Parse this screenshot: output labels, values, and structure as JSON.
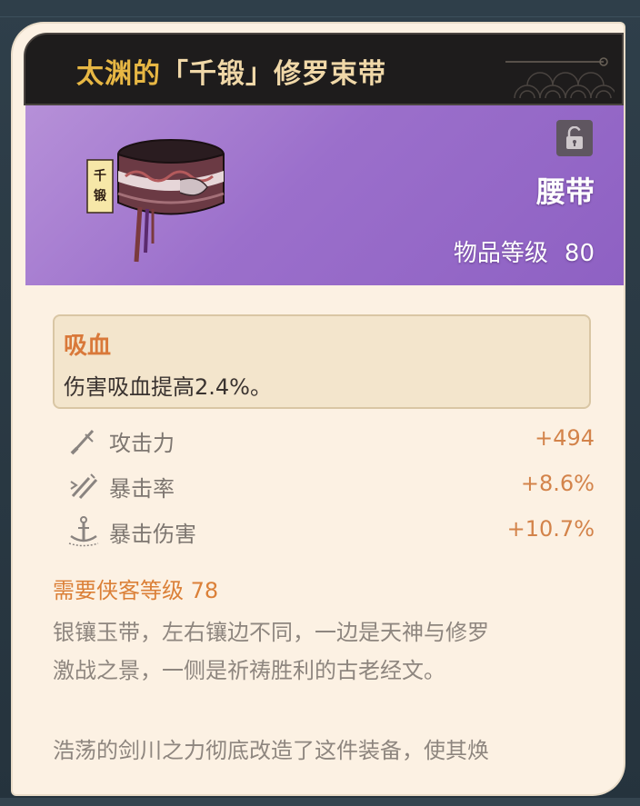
{
  "item": {
    "title_prefix": "太渊的",
    "title_main": "「千锻」修罗束带",
    "type": "腰带",
    "level_label": "物品等级",
    "level_value": "80",
    "art_tag": "千锻"
  },
  "effect": {
    "name": "吸血",
    "description": "伤害吸血提高2.4%。"
  },
  "stats": [
    {
      "icon": "sword-icon",
      "label": "攻击力",
      "value": "+494"
    },
    {
      "icon": "crit-swords-icon",
      "label": "暴击率",
      "value": "+8.6%"
    },
    {
      "icon": "anchor-icon",
      "label": "暴击伤害",
      "value": "+10.7%"
    }
  ],
  "requirement": "需要侠客等级 78",
  "description_lines": [
    "银镶玉带，左右镶边不同，一边是天神与修罗",
    "激战之景，一侧是祈祷胜利的古老经文。",
    "浩荡的剑川之力彻底改造了这件装备，使其焕"
  ],
  "colors": {
    "banner_purple": "#9b6fcb",
    "accent_orange": "#d9793a",
    "title_gold": "#e7b744"
  }
}
